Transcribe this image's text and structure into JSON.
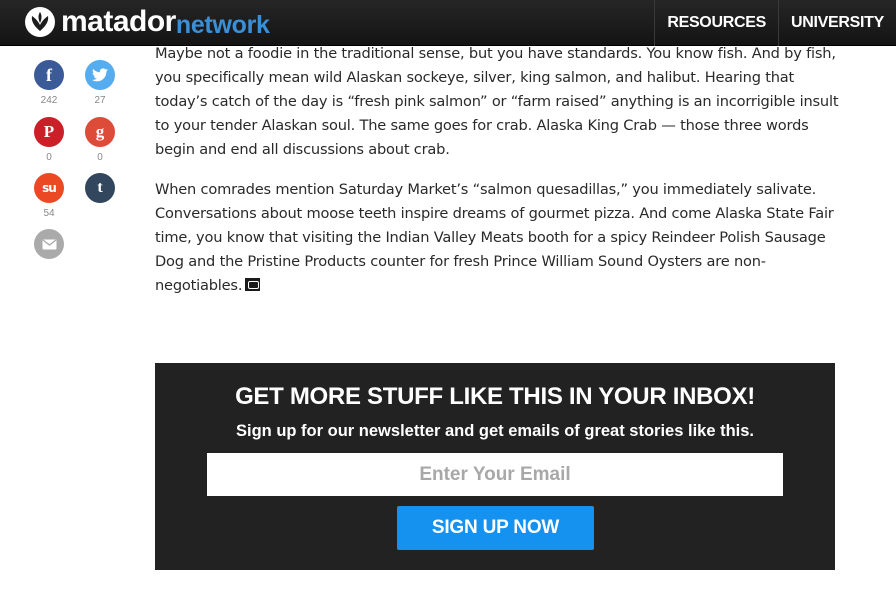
{
  "header": {
    "logo": {
      "primary": "matador",
      "secondary": "network",
      "accent_color": "#3b8fd6"
    },
    "nav": [
      {
        "label": "RESOURCES"
      },
      {
        "label": "UNIVERSITY"
      }
    ]
  },
  "share": {
    "buttons": [
      {
        "network": "facebook",
        "icon": "f",
        "color": "#3b5a98",
        "count": "242"
      },
      {
        "network": "twitter",
        "icon": "twitter-bird",
        "color": "#55acee",
        "count": "27"
      },
      {
        "network": "pinterest",
        "icon": "P",
        "color": "#cb2027",
        "count": "0"
      },
      {
        "network": "google-plus",
        "icon": "g",
        "color": "#dd4b39",
        "count": "0"
      },
      {
        "network": "stumbleupon",
        "icon": "su",
        "color": "#eb4924",
        "count": "54"
      },
      {
        "network": "tumblr",
        "icon": "t",
        "color": "#32465d",
        "count": ""
      },
      {
        "network": "email",
        "icon": "envelope",
        "color": "#aaaaaa",
        "count": ""
      }
    ]
  },
  "article": {
    "paragraphs": [
      "Maybe not a foodie in the traditional sense, but you have standards. You know fish. And by fish, you specifically mean wild Alaskan sockeye, silver, king salmon, and halibut. Hearing that today’s catch of the day is “fresh pink salmon” or “farm raised” anything is an incorrigible insult to your tender Alaskan soul. The same goes for crab. Alaska King Crab — those three words begin and end all discussions about crab.",
      "When comrades mention Saturday Market’s “salmon quesadillas,” you immediately salivate. Conversations about moose teeth inspire dreams of gourmet pizza. And come Alaska State Fair time, you know that visiting the Indian Valley Meats booth for a spicy Reindeer Polish Sausage Dog and the Pristine Products counter for fresh Prince William Sound Oysters are non-negotiables."
    ]
  },
  "newsletter": {
    "title": "GET MORE STUFF LIKE THIS IN YOUR INBOX!",
    "subtitle": "Sign up for our newsletter and get emails of great stories like this.",
    "email_placeholder": "Enter Your Email",
    "email_value": "",
    "button_label": "SIGN UP NOW",
    "button_color": "#1592f0"
  }
}
